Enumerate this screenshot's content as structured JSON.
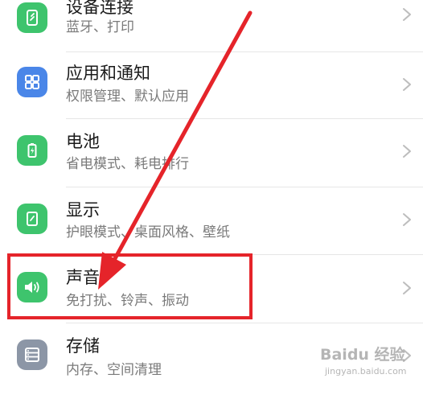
{
  "settings_list": {
    "items": [
      {
        "title": "设备连接",
        "subtitle": "蓝牙、打印",
        "icon": "device-connection-icon",
        "icon_color": "#3ec46d"
      },
      {
        "title": "应用和通知",
        "subtitle": "权限管理、默认应用",
        "icon": "apps-grid-icon",
        "icon_color": "#4a86e8"
      },
      {
        "title": "电池",
        "subtitle": "省电模式、耗电排行",
        "icon": "battery-icon",
        "icon_color": "#3ec46d"
      },
      {
        "title": "显示",
        "subtitle": "护眼模式、桌面风格、壁纸",
        "icon": "display-icon",
        "icon_color": "#3ec46d"
      },
      {
        "title": "声音",
        "subtitle": "免打扰、铃声、振动",
        "icon": "speaker-icon",
        "icon_color": "#3ec46d"
      },
      {
        "title": "存储",
        "subtitle": "内存、空间清理",
        "icon": "storage-icon",
        "icon_color": "#8c96a6"
      }
    ]
  },
  "annotation": {
    "highlight_color": "#e5242a",
    "highlighted_item": "声音"
  },
  "watermark": {
    "brand": "Baidu 经验",
    "sub": "jingyan.baidu.com"
  }
}
